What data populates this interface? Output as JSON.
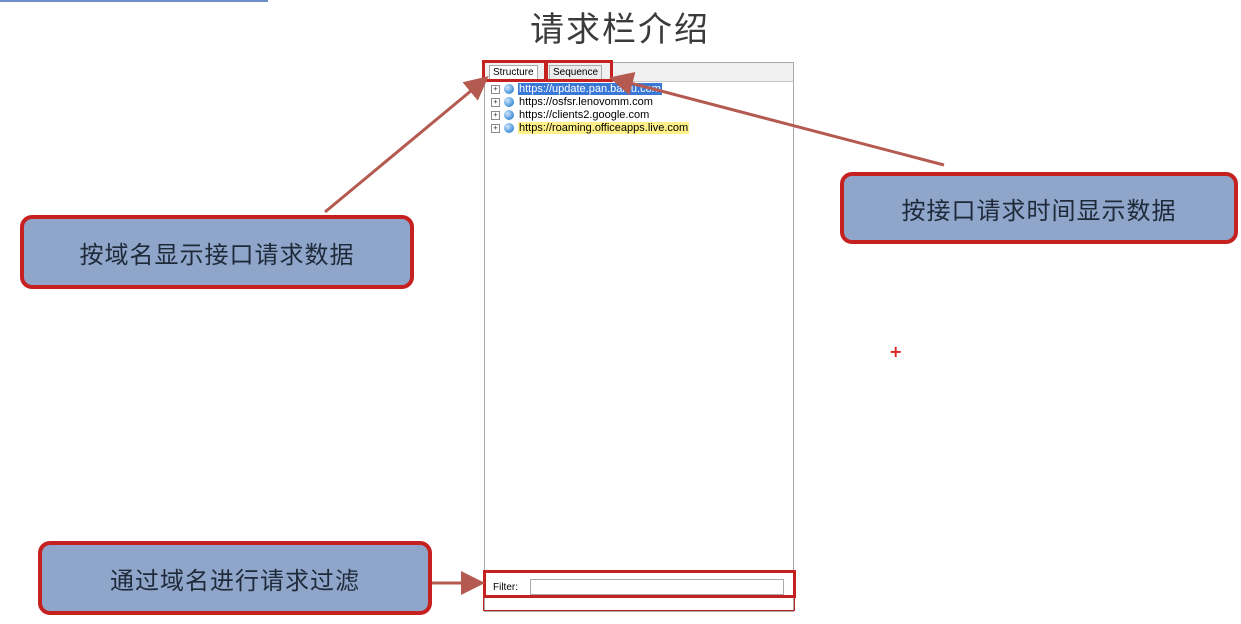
{
  "title": "请求栏介绍",
  "panel": {
    "tabs": [
      {
        "label": "Structure",
        "active": true
      },
      {
        "label": "Sequence",
        "active": false
      }
    ],
    "tree": [
      {
        "host": "https://update.pan.baidu.com",
        "state": "selected"
      },
      {
        "host": "https://osfsr.lenovomm.com",
        "state": "normal"
      },
      {
        "host": "https://clients2.google.com",
        "state": "normal"
      },
      {
        "host": "https://roaming.officeapps.live.com",
        "state": "highlighted"
      }
    ],
    "expander_glyph": "+",
    "filter_label": "Filter:",
    "filter_value": ""
  },
  "callouts": {
    "domain": "按域名显示接口请求数据",
    "time": "按接口请求时间显示数据",
    "filter": "通过域名进行请求过滤"
  },
  "colors": {
    "highlight_red": "#c62121",
    "callout_fill": "#8fa5c9",
    "arrow": "#b45a50",
    "selected": "#3a78d6",
    "highlighted": "#fff18a"
  },
  "cursor_glyph": "+"
}
